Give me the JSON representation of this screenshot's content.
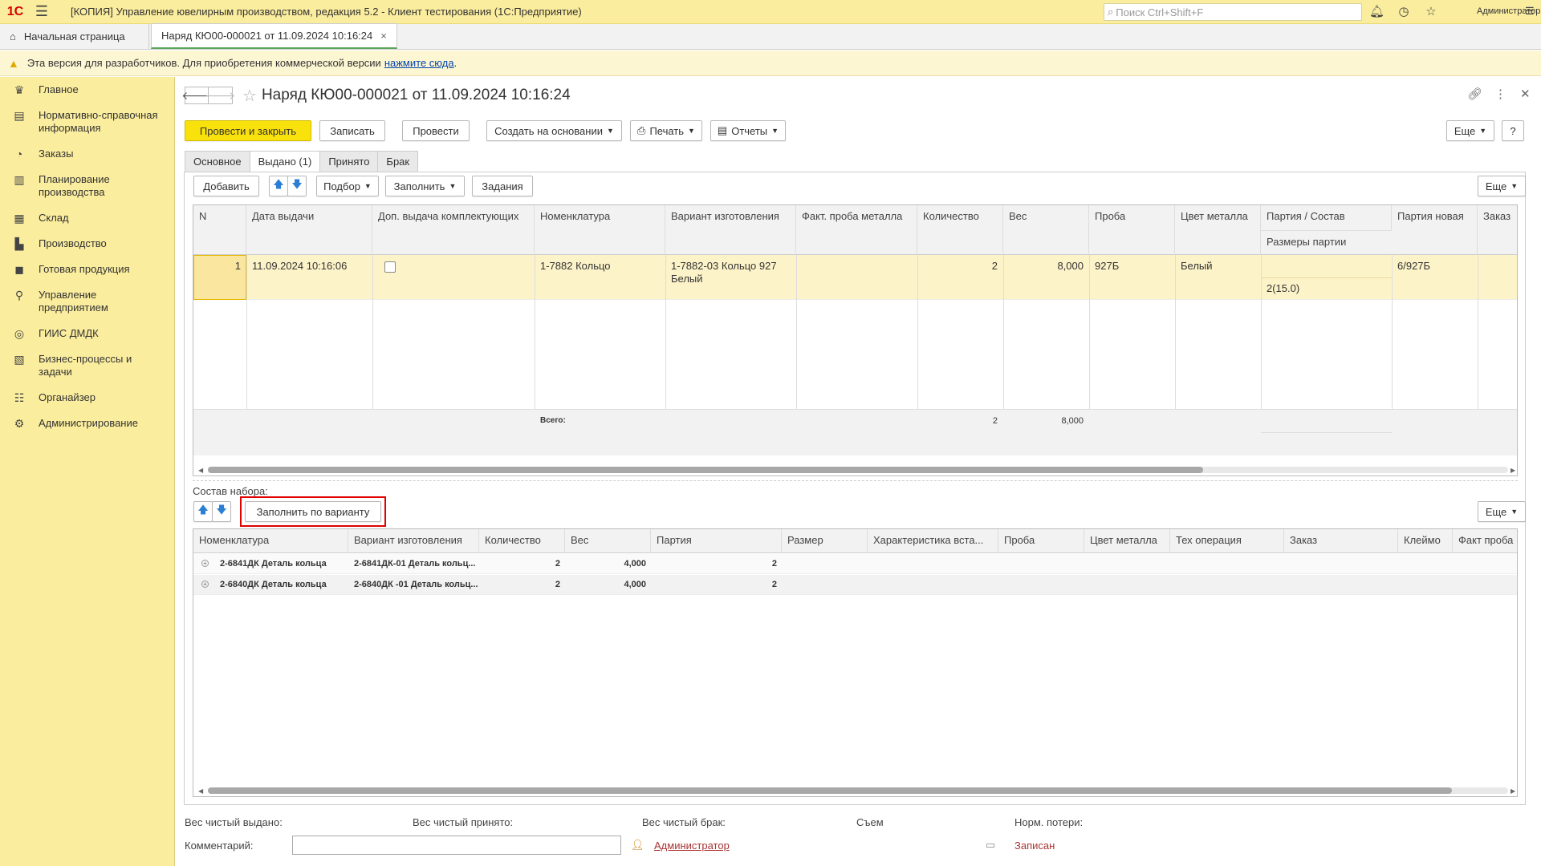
{
  "titlebar": {
    "logo": "1С",
    "app_title": "[КОПИЯ] Управление ювелирным производством, редакция 5.2  - Клиент тестирования (1С:Предприятие)",
    "search_placeholder": "Поиск Ctrl+Shift+F",
    "user": "Администратор"
  },
  "tabs": {
    "home": "Начальная страница",
    "active": "Наряд КЮ00-000021 от 11.09.2024 10:16:24"
  },
  "warning": {
    "text": "Эта версия для разработчиков. Для приобретения коммерческой версии",
    "link": "нажмите сюда",
    "tail": "."
  },
  "sidebar": {
    "items": [
      {
        "label": "Главное",
        "icon": "crown-icon"
      },
      {
        "label": "Нормативно-справочная информация",
        "icon": "books-icon"
      },
      {
        "label": "Заказы",
        "icon": "pie-icon"
      },
      {
        "label": "Планирование производства",
        "icon": "clipboard-icon"
      },
      {
        "label": "Склад",
        "icon": "warehouse-icon"
      },
      {
        "label": "Производство",
        "icon": "factory-icon"
      },
      {
        "label": "Готовая продукция",
        "icon": "bag-icon"
      },
      {
        "label": "Управление предприятием",
        "icon": "org-icon"
      },
      {
        "label": "ГИИС ДМДК",
        "icon": "ring-icon"
      },
      {
        "label": "Бизнес-процессы и задачи",
        "icon": "tasks-icon"
      },
      {
        "label": "Органайзер",
        "icon": "organizer-icon"
      },
      {
        "label": "Администрирование",
        "icon": "gear-icon"
      }
    ]
  },
  "doc": {
    "title": "Наряд КЮ00-000021 от 11.09.2024 10:16:24"
  },
  "toolbar": {
    "post_close": "Провести и закрыть",
    "save": "Записать",
    "post": "Провести",
    "create_based": "Создать на основании",
    "print": "Печать",
    "reports": "Отчеты",
    "more": "Еще",
    "help": "?"
  },
  "form_tabs": [
    "Основное",
    "Выдано (1)",
    "Принято",
    "Брак"
  ],
  "issued": {
    "toolbar": {
      "add": "Добавить",
      "pick": "Подбор",
      "fill": "Заполнить",
      "tasks": "Задания",
      "more": "Еще"
    },
    "columns": [
      "N",
      "Дата выдачи",
      "Доп. выдача комплектующих",
      "Номенклатура",
      "Вариант изготовления",
      "Факт. проба металла",
      "Количество",
      "Вес",
      "Проба",
      "Цвет металла",
      "Партия / Состав",
      "Партия новая",
      "Заказ"
    ],
    "subcolumn": "Размеры партии",
    "row": {
      "n": "1",
      "date": "11.09.2024 10:16:06",
      "nomenclature": "1-7882 Кольцо",
      "variant": "1-7882-03 Кольцо 927 Белый",
      "qty": "2",
      "weight": "8,000",
      "probe": "927Б",
      "color": "Белый",
      "sizes": "2(15.0)",
      "new_batch": "6/927Б"
    },
    "footer": {
      "label": "Всего:",
      "qty": "2",
      "weight": "8,000"
    }
  },
  "kit": {
    "label": "Состав набора:",
    "fill_by_variant": "Заполнить по варианту",
    "more": "Еще",
    "columns": [
      "Номенклатура",
      "Вариант изготовления",
      "Количество",
      "Вес",
      "Партия",
      "Размер",
      "Характеристика вста...",
      "Проба",
      "Цвет металла",
      "Тех операция",
      "Заказ",
      "Клеймо",
      "Факт проба"
    ],
    "rows": [
      {
        "nomenclature": "2-6841ДК Деталь кольца",
        "variant": "2-6841ДК-01 Деталь кольц...",
        "qty": "2",
        "weight": "4,000",
        "batch": "2"
      },
      {
        "nomenclature": "2-6840ДК Деталь кольца",
        "variant": "2-6840ДК -01 Деталь кольц...",
        "qty": "2",
        "weight": "4,000",
        "batch": "2"
      }
    ]
  },
  "bottom": {
    "net_issued": "Вес чистый выдано:",
    "net_received": "Вес чистый принято:",
    "net_defect": "Вес чистый брак:",
    "removal": "Съем",
    "norm_loss": "Норм. потери:",
    "comment": "Комментарий:",
    "author": "Администратор",
    "status": "Записан"
  }
}
